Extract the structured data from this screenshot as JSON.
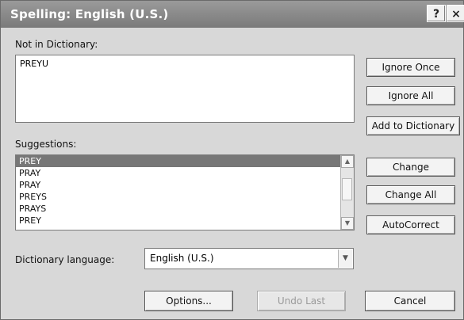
{
  "window": {
    "title": "Spelling: English (U.S.)",
    "help_label": "?",
    "close_label": "×"
  },
  "not_in_dictionary": {
    "label": "Not in Dictionary:",
    "value": "PREYU"
  },
  "suggestions": {
    "label": "Suggestions:",
    "items": [
      "PREY",
      "PRAY",
      "PRAY",
      "PREYS",
      "PRAYS",
      "PREY"
    ]
  },
  "dictionary_language": {
    "label": "Dictionary language:",
    "value": "English (U.S.)"
  },
  "buttons": {
    "ignore_once": "Ignore Once",
    "ignore_all": "Ignore All",
    "add_to_dictionary": "Add to Dictionary",
    "change": "Change",
    "change_all": "Change All",
    "autocorrect": "AutoCorrect",
    "options": "Options...",
    "undo_last": "Undo Last",
    "cancel": "Cancel"
  }
}
